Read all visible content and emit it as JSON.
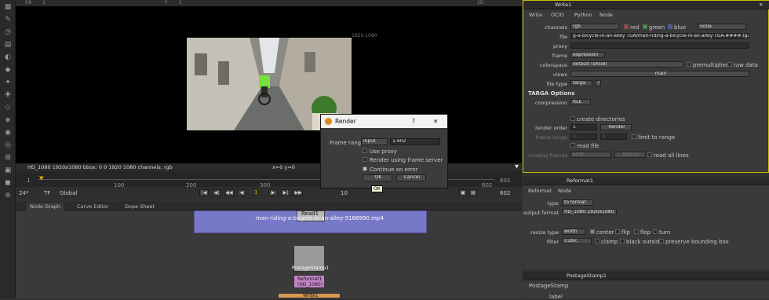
{
  "viewer": {
    "top_left": "f/8",
    "top_num": "1",
    "y_label": "Y",
    "y_val": "1",
    "res_label": "2D",
    "corner_label": "1920,1080",
    "info": "HD_1080 1920x1080  bbox: 0 0 1920 1080 channels: rgb",
    "coords": "x=0 y=0"
  },
  "timeline": {
    "ticks": [
      "1",
      "100",
      "200",
      "300",
      "400",
      "500",
      "602"
    ],
    "start": "1",
    "end": "602",
    "end2": "602",
    "fps": "24*",
    "tf": "TF",
    "mode": "Global",
    "frame": "1",
    "inc": "10"
  },
  "tabs": [
    "Node Graph",
    "Curve Editor",
    "Dope Sheet"
  ],
  "nodes": {
    "read_label": "Read1",
    "read_file": "man-riding-a-bicycle-in-an-alley-5168990.mp4",
    "postage": "PostageStamp1",
    "reformat": "Reformat1",
    "reformat_sub": "(HD_1080)",
    "write": "Write1"
  },
  "write_panel": {
    "title": "Write1",
    "tabs": [
      "Write",
      "OCIO",
      "Python",
      "Node"
    ],
    "channels_label": "channels",
    "channels_val": "rgb",
    "red": "red",
    "green": "green",
    "blue": "blue",
    "none": "none",
    "file_label": "file",
    "file_val": "g-a-bicycle-in-an-alley TGA/man-riding-a-bicycle-in-an-alley TGA.####.tga",
    "proxy_label": "proxy",
    "frame_label": "frame",
    "frame_val": "expression",
    "colorspace_label": "colorspace",
    "colorspace_val": "default (sRGB)",
    "premult": "premultiplied",
    "rawdata": "raw data",
    "views_label": "views",
    "views_val": "main",
    "filetype_label": "file type",
    "filetype_val": "targa",
    "help": "?",
    "targa_header": "TARGA Options",
    "compression_label": "compression",
    "compression_val": "RLE",
    "create_dirs": "create directories",
    "render_order_label": "render order",
    "render_order_val": "1",
    "render_btn": "Render",
    "frame_range_label": "frame range",
    "fr1": "1",
    "fr2": "1",
    "limit": "limit to range",
    "read_file": "read file",
    "missing_label": "missing frames",
    "missing_val": "error",
    "reload": "Reload",
    "read_all": "read all lines"
  },
  "reformat_panel": {
    "title": "Reformat1",
    "tabs": [
      "Reformat",
      "Node"
    ],
    "type_label": "type",
    "type_val": "to format",
    "outfmt_label": "output format",
    "outfmt_val": "HD_1080 1920x1080",
    "resize_label": "resize type",
    "resize_val": "width",
    "center": "center",
    "flip": "flip",
    "flop": "flop",
    "turn": "turn",
    "filter_label": "filter",
    "filter_val": "Cubic",
    "clamp": "clamp",
    "black": "black outside",
    "preserve": "preserve bounding box"
  },
  "postage_panel": {
    "title": "PostageStamp1",
    "tab": "PostageStamp",
    "label_label": "label"
  },
  "dialog": {
    "title": "Render",
    "help": "?",
    "close": "✕",
    "frame_range_label": "Frame range",
    "range_mode": "input",
    "range_val": "1-602",
    "use_proxy": "Use proxy",
    "render_server": "Render using frame server",
    "continue": "Continue on error",
    "ok": "OK",
    "cancel": "Cancel",
    "tooltip": "OK"
  }
}
